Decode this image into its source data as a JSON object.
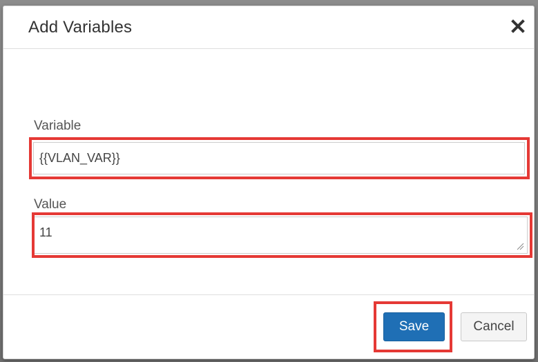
{
  "dialog": {
    "title": "Add Variables",
    "close_icon": "close-icon"
  },
  "form": {
    "variable": {
      "label": "Variable",
      "value": "{{VLAN_VAR}}"
    },
    "value": {
      "label": "Value",
      "value": "11"
    }
  },
  "footer": {
    "save_label": "Save",
    "cancel_label": "Cancel"
  },
  "colors": {
    "highlight": "#e53935",
    "primary_button": "#1f6fb5"
  }
}
